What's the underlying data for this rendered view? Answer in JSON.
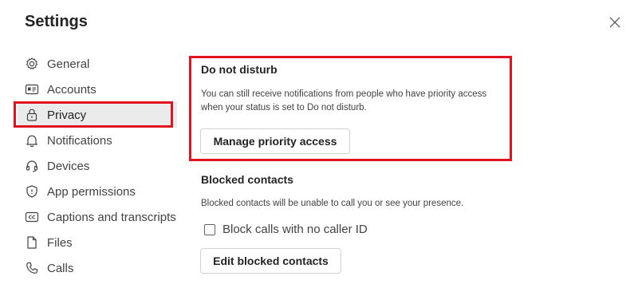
{
  "dialog": {
    "title": "Settings"
  },
  "nav": {
    "items": [
      {
        "label": "General",
        "icon": "gear-icon"
      },
      {
        "label": "Accounts",
        "icon": "id-card-icon"
      },
      {
        "label": "Privacy",
        "icon": "lock-icon"
      },
      {
        "label": "Notifications",
        "icon": "bell-icon"
      },
      {
        "label": "Devices",
        "icon": "headset-icon"
      },
      {
        "label": "App permissions",
        "icon": "shield-icon"
      },
      {
        "label": "Captions and transcripts",
        "icon": "captions-icon"
      },
      {
        "label": "Files",
        "icon": "file-icon"
      },
      {
        "label": "Calls",
        "icon": "phone-icon"
      }
    ],
    "selected": "Privacy"
  },
  "dnd": {
    "title": "Do not disturb",
    "description": "You can still receive notifications from people who have priority access when your status is set to Do not disturb.",
    "button": "Manage priority access"
  },
  "blocked": {
    "title": "Blocked contacts",
    "description": "Blocked contacts will be unable to call you or see your presence.",
    "checkbox_label": "Block calls with no caller ID",
    "checkbox_checked": false,
    "button": "Edit blocked contacts"
  },
  "colors": {
    "highlight": "#e0141e",
    "selected_bg": "#ebebeb"
  }
}
